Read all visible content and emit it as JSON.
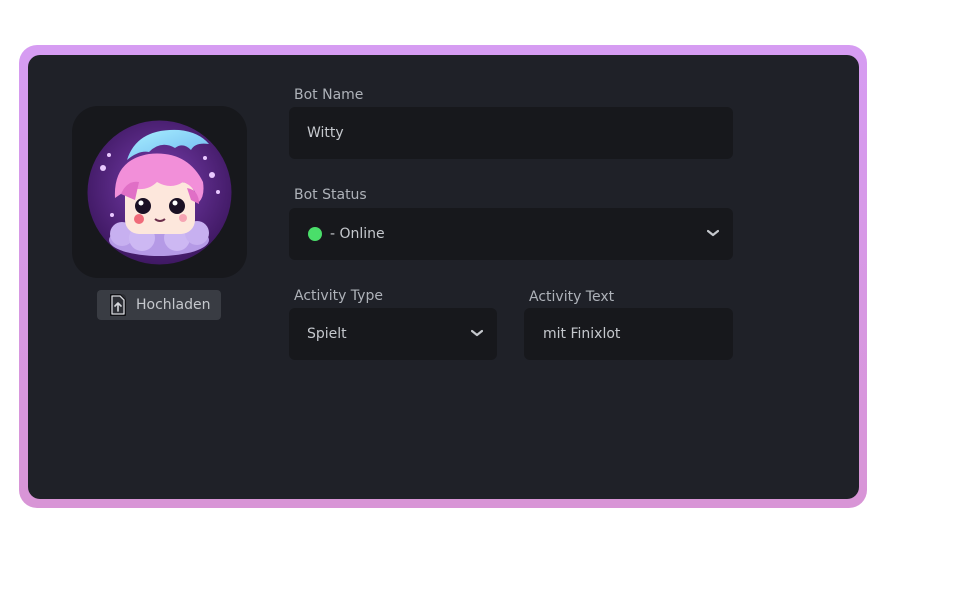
{
  "profile": {
    "upload_label": "Hochladen"
  },
  "form": {
    "bot_name_label": "Bot Name",
    "bot_name_value": "Witty",
    "bot_status_label": "Bot Status",
    "bot_status_value": "- Online",
    "bot_status_color": "#4ade6a",
    "activity_type_label": "Activity Type",
    "activity_type_value": "Spielt",
    "activity_text_label": "Activity Text",
    "activity_text_value": "mit Finixlot"
  },
  "theme": {
    "frame_gradient": [
      "#d69cf2",
      "#d895d6"
    ],
    "panel_bg": "#1f2128",
    "field_bg": "#17181c"
  },
  "icons": {
    "upload": "file-upload-icon",
    "dropdown": "chevron-down-icon",
    "status": "status-dot-icon"
  }
}
